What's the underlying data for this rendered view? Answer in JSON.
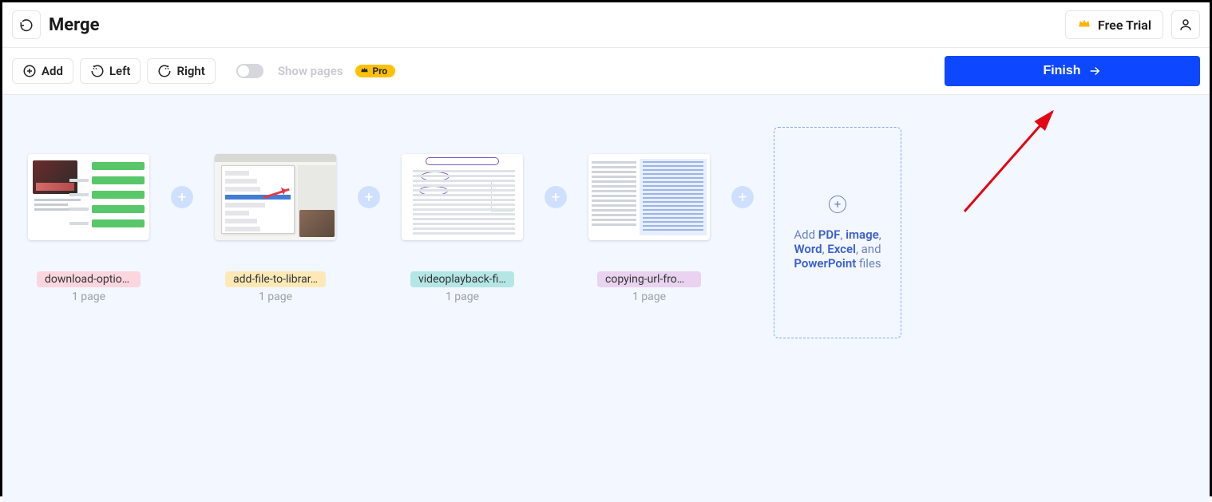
{
  "header": {
    "title": "Merge",
    "free_trial": "Free Trial"
  },
  "toolbar": {
    "add": "Add",
    "left": "Left",
    "right": "Right",
    "show_pages": "Show pages",
    "pro": "Pro",
    "finish": "Finish"
  },
  "files": [
    {
      "name": "download-option…",
      "pages": "1 page",
      "color": "fn-pink"
    },
    {
      "name": "add-file-to-librar…",
      "pages": "1 page",
      "color": "fn-yellow"
    },
    {
      "name": "videoplayback-fil…",
      "pages": "1 page",
      "color": "fn-teal"
    },
    {
      "name": "copying-url-from…",
      "pages": "1 page",
      "color": "fn-violet"
    }
  ],
  "dropzone": {
    "prefix": "Add ",
    "pdf": "PDF",
    "sep1": ", ",
    "image": "image",
    "sep2": ", ",
    "word": "Word",
    "sep3": ", ",
    "excel": "Excel",
    "sep4": ", and ",
    "powerpoint": "PowerPoint",
    "suffix": " files"
  }
}
